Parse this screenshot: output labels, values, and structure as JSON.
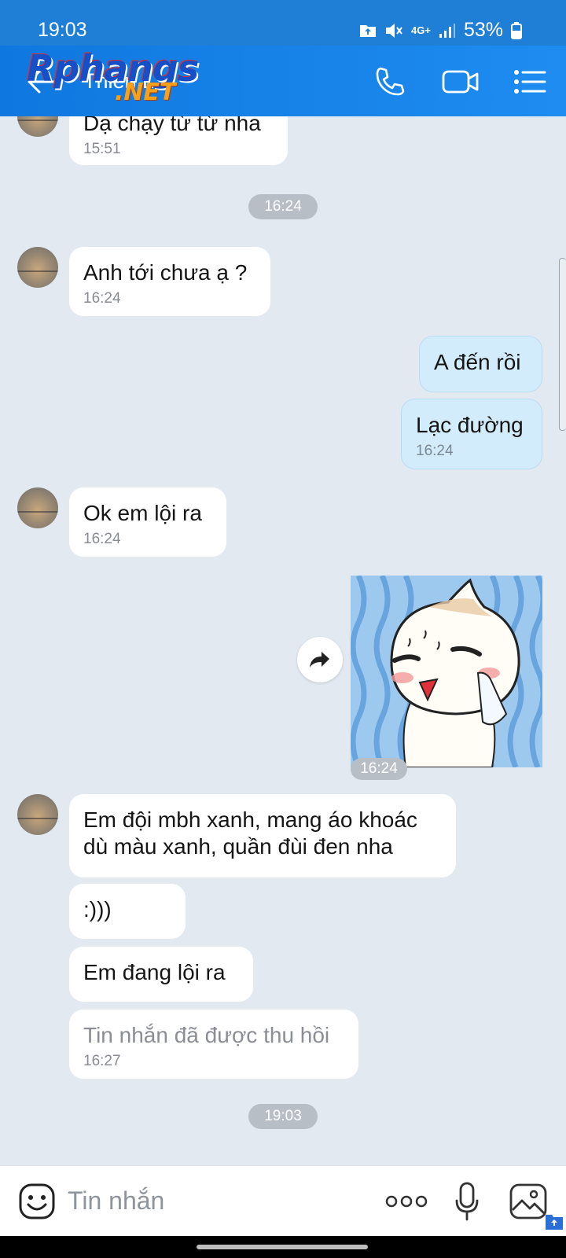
{
  "status_bar": {
    "time": "19:03",
    "network": "4G+",
    "battery": "53%"
  },
  "header": {
    "contact_name": "Thien L",
    "logo_main": "Rphangs",
    "logo_sub": ".NET",
    "icons": [
      "back-arrow-icon",
      "phone-icon",
      "video-call-icon",
      "menu-list-icon"
    ]
  },
  "messages": [
    {
      "dir": "in",
      "text": "Dạ chạy từ từ nha",
      "time": "15:51"
    },
    {
      "separator": "16:24"
    },
    {
      "dir": "in",
      "text": "Anh tới chưa ạ ?",
      "time": "16:24"
    },
    {
      "dir": "out",
      "text": "A đến rồi"
    },
    {
      "dir": "out",
      "text": "Lạc đường",
      "time": "16:24"
    },
    {
      "dir": "in",
      "text": "Ok em lội ra",
      "time": "16:24"
    },
    {
      "dir": "out",
      "sticker": "crying-bun-sticker",
      "time": "16:24"
    },
    {
      "dir": "in",
      "text_line1": "Em đội mbh xanh, mang áo khoác",
      "text_line2": "dù màu xanh, quần đùi đen nha"
    },
    {
      "dir": "in",
      "text": ":)))"
    },
    {
      "dir": "in",
      "text": "Em đang lội ra"
    },
    {
      "dir": "in",
      "text": "Tin nhắn đã được thu hồi",
      "time": "16:27",
      "recalled": true
    },
    {
      "separator": "19:03"
    }
  ],
  "input": {
    "placeholder": "Tin nhắn",
    "icons": [
      "emoji-icon",
      "more-options-icon",
      "microphone-icon",
      "image-icon"
    ]
  },
  "colors": {
    "header_blue": "#1e8cf0",
    "chat_bg": "#e2e9f1",
    "outgoing_bubble": "#d3ecfc",
    "incoming_bubble": "#ffffff"
  }
}
